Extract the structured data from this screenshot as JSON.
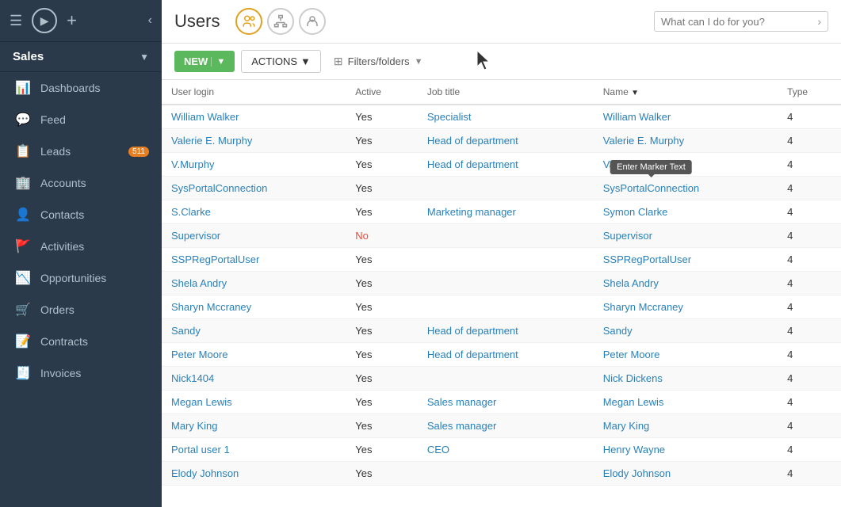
{
  "sidebar": {
    "title": "Sales",
    "nav_items": [
      {
        "id": "dashboards",
        "label": "Dashboards",
        "icon": "📊",
        "badge": null
      },
      {
        "id": "feed",
        "label": "Feed",
        "icon": "💬",
        "badge": null
      },
      {
        "id": "leads",
        "label": "Leads",
        "icon": "📋",
        "badge": "511"
      },
      {
        "id": "accounts",
        "label": "Accounts",
        "icon": "🏢",
        "badge": null
      },
      {
        "id": "contacts",
        "label": "Contacts",
        "icon": "👤",
        "badge": null
      },
      {
        "id": "activities",
        "label": "Activities",
        "icon": "🚩",
        "badge": null
      },
      {
        "id": "opportunities",
        "label": "Opportunities",
        "icon": "📉",
        "badge": null
      },
      {
        "id": "orders",
        "label": "Orders",
        "icon": "🛒",
        "badge": null
      },
      {
        "id": "contracts",
        "label": "Contracts",
        "icon": "📝",
        "badge": null
      },
      {
        "id": "invoices",
        "label": "Invoices",
        "icon": "🧾",
        "badge": null
      }
    ]
  },
  "header": {
    "title": "Users",
    "search_placeholder": "What can I do for you?"
  },
  "toolbar": {
    "new_label": "NEW",
    "actions_label": "ACTIONS",
    "filters_label": "Filters/folders"
  },
  "table": {
    "columns": [
      {
        "id": "user_login",
        "label": "User login",
        "sortable": false
      },
      {
        "id": "active",
        "label": "Active",
        "sortable": false
      },
      {
        "id": "job_title",
        "label": "Job title",
        "sortable": false
      },
      {
        "id": "name",
        "label": "Name",
        "sortable": true
      },
      {
        "id": "type",
        "label": "Type",
        "sortable": false
      }
    ],
    "rows": [
      {
        "user_login": "William Walker",
        "active": "Yes",
        "job_title": "Specialist",
        "name": "William Walker",
        "type": "4"
      },
      {
        "user_login": "Valerie E. Murphy",
        "active": "Yes",
        "job_title": "Head of department",
        "name": "Valerie E. Murphy",
        "type": "4"
      },
      {
        "user_login": "V.Murphy",
        "active": "Yes",
        "job_title": "Head of department",
        "name": "Valerie E. Murphy",
        "type": "4"
      },
      {
        "user_login": "SysPortalConnection",
        "active": "Yes",
        "job_title": "",
        "name": "SysPortalConnection",
        "type": "4",
        "tooltip": "Enter Marker Text"
      },
      {
        "user_login": "S.Clarke",
        "active": "Yes",
        "job_title": "Marketing manager",
        "name": "Symon Clarke",
        "type": "4"
      },
      {
        "user_login": "Supervisor",
        "active": "No",
        "job_title": "",
        "name": "Supervisor",
        "type": "4"
      },
      {
        "user_login": "SSPRegPortalUser",
        "active": "Yes",
        "job_title": "",
        "name": "SSPRegPortalUser",
        "type": "4"
      },
      {
        "user_login": "Shela Andry",
        "active": "Yes",
        "job_title": "",
        "name": "Shela Andry",
        "type": "4"
      },
      {
        "user_login": "Sharyn Mccraney",
        "active": "Yes",
        "job_title": "",
        "name": "Sharyn Mccraney",
        "type": "4"
      },
      {
        "user_login": "Sandy",
        "active": "Yes",
        "job_title": "Head of department",
        "name": "Sandy",
        "type": "4"
      },
      {
        "user_login": "Peter Moore",
        "active": "Yes",
        "job_title": "Head of department",
        "name": "Peter Moore",
        "type": "4"
      },
      {
        "user_login": "Nick1404",
        "active": "Yes",
        "job_title": "",
        "name": "Nick Dickens",
        "type": "4"
      },
      {
        "user_login": "Megan Lewis",
        "active": "Yes",
        "job_title": "Sales manager",
        "name": "Megan Lewis",
        "type": "4"
      },
      {
        "user_login": "Mary King",
        "active": "Yes",
        "job_title": "Sales manager",
        "name": "Mary King",
        "type": "4"
      },
      {
        "user_login": "Portal user 1",
        "active": "Yes",
        "job_title": "CEO",
        "name": "Henry Wayne",
        "type": "4"
      },
      {
        "user_login": "Elody Johnson",
        "active": "Yes",
        "job_title": "",
        "name": "Elody Johnson",
        "type": "4"
      }
    ]
  }
}
